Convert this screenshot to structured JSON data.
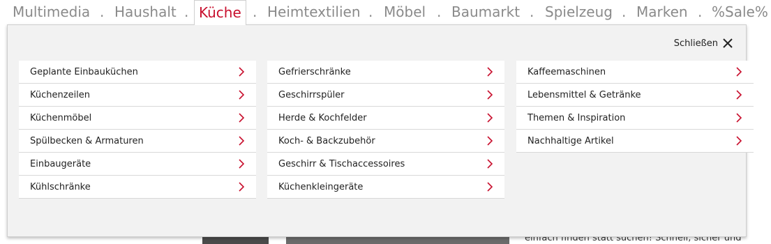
{
  "nav": {
    "items": [
      "Multimedia",
      "Haushalt",
      "Küche",
      "Heimtextilien",
      "Möbel",
      "Baumarkt",
      "Spielzeug",
      "Marken",
      "%Sale%"
    ],
    "separator": ".",
    "active_index": 2
  },
  "panel": {
    "close_label": "Schließen",
    "columns": [
      [
        "Geplante Einbauküchen",
        "Küchenzeilen",
        "Küchenmöbel",
        "Spülbecken & Armaturen",
        "Einbaugeräte",
        "Kühlschränke"
      ],
      [
        "Gefrierschränke",
        "Geschirrspüler",
        "Herde & Kochfelder",
        "Koch- & Backzubehör",
        "Geschirr & Tischaccessoires",
        "Küchenkleingeräte"
      ],
      [
        "Kaffeemaschinen",
        "Lebensmittel & Getränke",
        "Themen & Inspiration",
        "Nachhaltige Artikel"
      ]
    ]
  },
  "background": {
    "text_fragment": "einfach finden statt suchen! Schnell, sicher und"
  },
  "colors": {
    "accent": "#c8102e",
    "nav_text": "#8a8a8a",
    "panel_bg": "#f2f2f2",
    "item_bg": "#ffffff"
  },
  "icons": {
    "close": "close-icon",
    "item_arrow": "chevron-right-icon"
  }
}
